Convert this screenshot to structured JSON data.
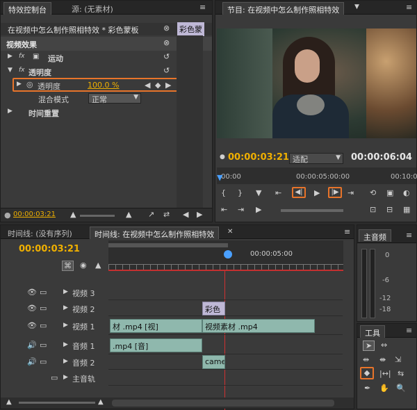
{
  "effect_panel": {
    "tab_active": "特效控制台",
    "tab_source": "源: (无素材)",
    "clip_title": "在视频中怎么制作照相特效 * 彩色蒙板",
    "clip_label": "彩色蒙",
    "video_effects_label": "视频效果",
    "motion_label": "运动",
    "opacity_group_label": "透明度",
    "opacity_prop_label": "透明度",
    "opacity_value": "100.0 %",
    "blend_mode_label": "混合模式",
    "blend_mode_value": "正常",
    "time_remap_label": "时间重置",
    "timecode": "00:00:03:21"
  },
  "program_monitor": {
    "tab_label": "节目: 在视频中怎么制作照相特效",
    "timecode": "00:00:03:21",
    "fit_value": "适配",
    "duration": "00:00:06:04",
    "ruler_start": "00:00",
    "ruler_mid": "00:00:05:00:00",
    "ruler_end": "00:10:0"
  },
  "timeline": {
    "tab_empty": "时间线: (没有序列)",
    "tab_active": "时间线: 在视频中怎么制作照相特效",
    "timecode": "00:00:03:21",
    "ruler_mark": "00:00:05:00",
    "tracks": {
      "v3": "视频 3",
      "v2": "视频 2",
      "v1": "视频 1",
      "a1": "音频 1",
      "a2": "音频 2",
      "master": "主音轨"
    },
    "clips": {
      "v2_clip": "彩色",
      "v1_clip_left": "材 .mp4 [视]",
      "v1_clip_right": "视频素材 .mp4",
      "a1_clip": ".mp4 [音]",
      "a2_clip": "camer"
    }
  },
  "audio_master": {
    "title": "主音频",
    "scale": [
      "0",
      "-6",
      "-12",
      "-18"
    ]
  },
  "tools": {
    "title": "工具"
  }
}
